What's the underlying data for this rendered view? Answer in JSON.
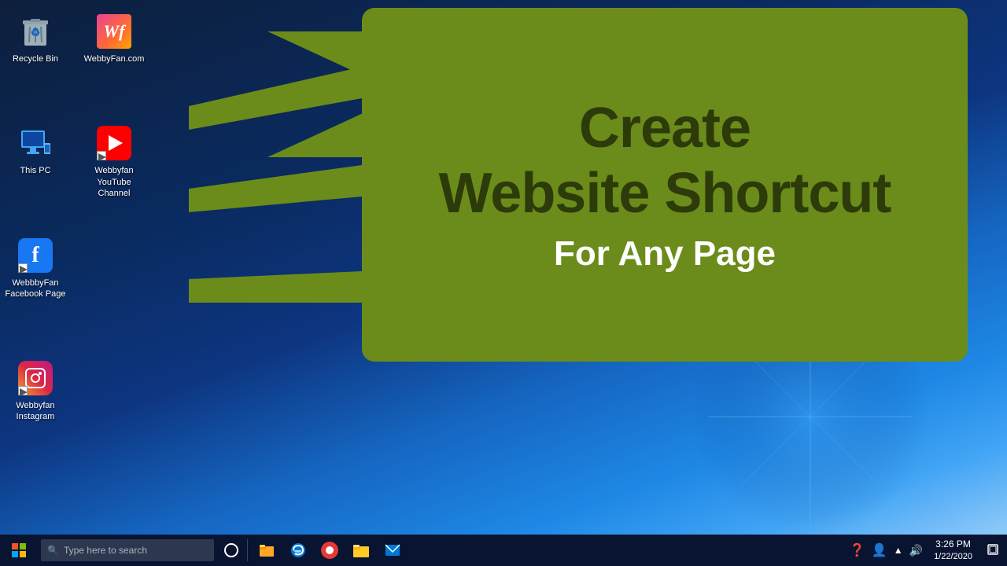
{
  "desktop": {
    "background_primary": "#0a1628",
    "background_secondary": "#1565c0"
  },
  "icons": {
    "col1": [
      {
        "id": "recycle-bin",
        "label": "Recycle Bin",
        "type": "recycle"
      },
      {
        "id": "this-pc",
        "label": "This PC",
        "type": "thispc"
      },
      {
        "id": "webbyfan-facebook",
        "label": "WebbbyFan\nFacebook Page",
        "label_line1": "WebbbyFan",
        "label_line2": "Facebook Page",
        "type": "facebook"
      },
      {
        "id": "webbyfan-instagram",
        "label": "Webbyfan\nInstagram",
        "label_line1": "Webbyfan",
        "label_line2": "Instagram",
        "type": "instagram"
      }
    ],
    "col2": [
      {
        "id": "webbyfan-com",
        "label": "WebbyFan.com",
        "type": "webbyfan"
      },
      {
        "id": "webbyfan-youtube",
        "label": "Webbyfan\nYouTube Channel",
        "label_line1": "Webbyfan",
        "label_line2": "YouTube Channel",
        "type": "youtube"
      }
    ]
  },
  "speech_bubble": {
    "title_line1": "Create",
    "title_line2": "Website Shortcut",
    "subtitle": "For Any Page",
    "bg_color": "#6b8c1a"
  },
  "taskbar": {
    "search_placeholder": "Type here to search",
    "clock_time": "3:26 PM",
    "clock_date": "1/22/2020"
  }
}
